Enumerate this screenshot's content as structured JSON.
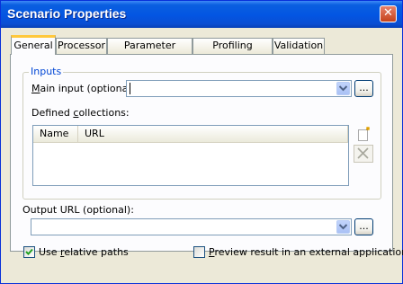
{
  "window": {
    "title": "Scenario Properties",
    "close_glyph": "✕"
  },
  "tabs": [
    {
      "label": "General",
      "active": true
    },
    {
      "label": "Processor",
      "active": false
    },
    {
      "label": "Parameter Values",
      "active": false
    },
    {
      "label": "Profiling Options",
      "active": false
    },
    {
      "label": "Validation",
      "active": false
    }
  ],
  "inputs_group": {
    "legend": "Inputs",
    "main_input_label_pre": "M",
    "main_input_label_post": "ain input (optional):",
    "main_input_value": "",
    "browse_label": "...",
    "collections_label_pre": "Defined ",
    "collections_label_u": "c",
    "collections_label_post": "ollections:",
    "columns": [
      "Name",
      "URL"
    ],
    "rows": []
  },
  "output": {
    "label": "Output URL (optional):",
    "value": "",
    "browse_label": "..."
  },
  "options": {
    "use_relative_pre": "Use ",
    "use_relative_u": "r",
    "use_relative_post": "elative paths",
    "use_relative_checked": true,
    "preview_pre": "",
    "preview_u": "P",
    "preview_post": "review result in an external application",
    "preview_checked": false
  },
  "icons": [
    "close-icon",
    "dropdown-arrow-icon",
    "new-collection-icon",
    "delete-collection-icon",
    "checkmark-icon"
  ]
}
